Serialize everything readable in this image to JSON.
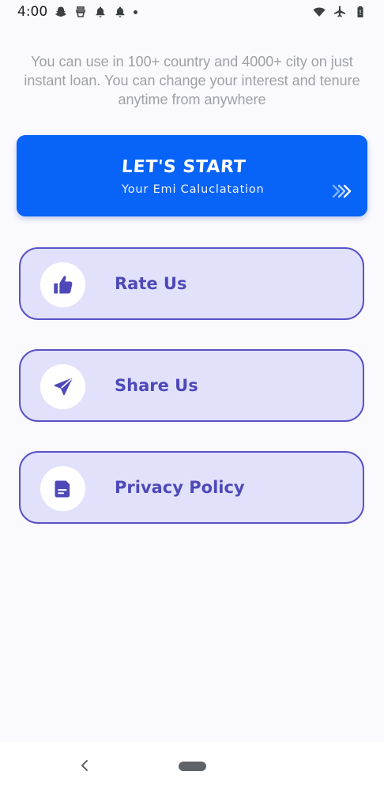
{
  "status_bar": {
    "time": "4:00",
    "left_icons": [
      "snapchat-icon",
      "app-icon",
      "notification-icon",
      "notification-icon",
      "dot-icon"
    ],
    "right_icons": [
      "wifi-icon",
      "airplane-icon",
      "battery-icon"
    ]
  },
  "intro_text": "You can use in 100+ country and 4000+ city on just instant loan. You can change your interest and tenure anytime from anywhere",
  "start_card": {
    "title": "LET'S START",
    "subtitle": "Your Emi Caluclatation",
    "icon": "double-chevron-right-icon",
    "color": "#0863f9"
  },
  "menu": [
    {
      "label": "Rate Us",
      "icon": "thumbs-up-icon"
    },
    {
      "label": "Share Us",
      "icon": "send-icon"
    },
    {
      "label": "Privacy Policy",
      "icon": "document-icon"
    }
  ],
  "colors": {
    "accent": "#4e49b8",
    "card_fill": "#e2e1fc",
    "card_border": "#5a52c8",
    "intro_text": "#9ea1a6"
  },
  "nav_bar": {
    "back_icon": "back-chevron-icon",
    "home_icon": "home-pill-icon"
  }
}
